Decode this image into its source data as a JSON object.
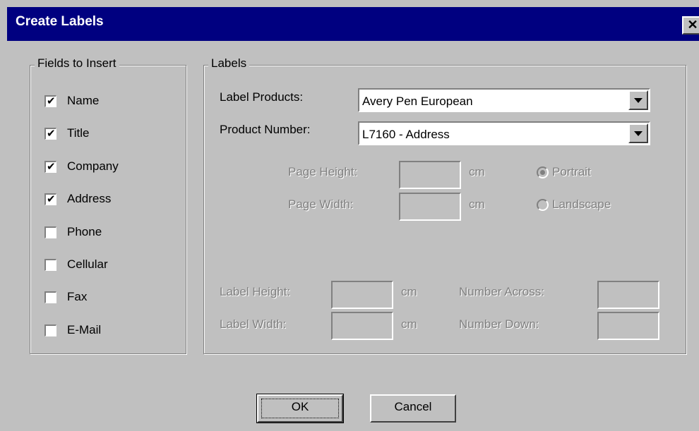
{
  "window": {
    "title": "Create Labels",
    "close_glyph": "✕"
  },
  "fields_group": {
    "legend": "Fields to Insert",
    "items": [
      {
        "label": "Name",
        "checked": true
      },
      {
        "label": "Title",
        "checked": true
      },
      {
        "label": "Company",
        "checked": true
      },
      {
        "label": "Address",
        "checked": true
      },
      {
        "label": "Phone",
        "checked": false
      },
      {
        "label": "Cellular",
        "checked": false
      },
      {
        "label": "Fax",
        "checked": false
      },
      {
        "label": "E-Mail",
        "checked": false
      }
    ]
  },
  "labels_group": {
    "legend": "Labels",
    "label_products_label": "Label Products:",
    "label_products_value": "Avery Pen European",
    "product_number_label": "Product Number:",
    "product_number_value": "L7160 - Address",
    "page_height_label": "Page Height:",
    "page_width_label": "Page Width:",
    "unit": "cm",
    "orientation": {
      "portrait": "Portrait",
      "landscape": "Landscape",
      "selected": "Portrait"
    },
    "label_height_label": "Label Height:",
    "label_width_label": "Label Width:",
    "number_across_label": "Number Across:",
    "number_down_label": "Number Down:"
  },
  "buttons": {
    "ok": "OK",
    "cancel": "Cancel"
  },
  "colors": {
    "titlebar": "#000080",
    "face": "#c0c0c0",
    "disabled_text": "#808080"
  }
}
